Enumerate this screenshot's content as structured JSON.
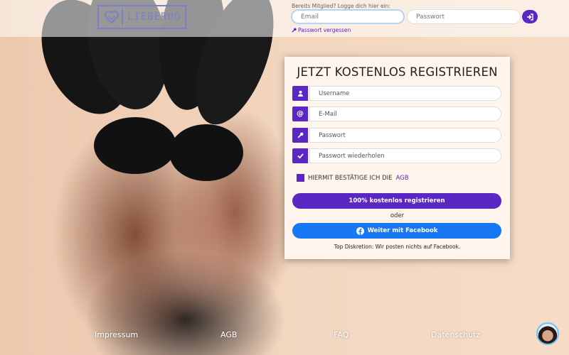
{
  "brand": {
    "logo_text": "LIEBEROO"
  },
  "login": {
    "label": "Bereits Mitglied? Logge dich hier ein:",
    "email_placeholder": "Email",
    "password_placeholder": "Passwort",
    "forgot_label": "Passwort vergessen"
  },
  "register": {
    "title": "JETZT KOSTENLOS REGISTRIEREN",
    "fields": [
      {
        "placeholder": "Username",
        "icon": "user-icon"
      },
      {
        "placeholder": "E-Mail",
        "icon": "at-icon"
      },
      {
        "placeholder": "Passwort",
        "icon": "key-icon"
      },
      {
        "placeholder": "Passwort wiederholen",
        "icon": "check-icon"
      }
    ],
    "agb_text": "HIERMIT BESTÄTIGE ICH DIE",
    "agb_link": "AGB",
    "submit_label": "100% kostenlos registrieren",
    "or_label": "oder",
    "facebook_label": "Weiter mit Facebook",
    "facebook_note": "Top Diskretion: Wir posten nichts auf Facebook."
  },
  "footer": {
    "links": [
      "Impressum",
      "AGB",
      "FAQ",
      "Datenschutz"
    ]
  },
  "colors": {
    "primary": "#5a26c4",
    "facebook": "#1877f2",
    "logo": "#7b7fc9"
  }
}
